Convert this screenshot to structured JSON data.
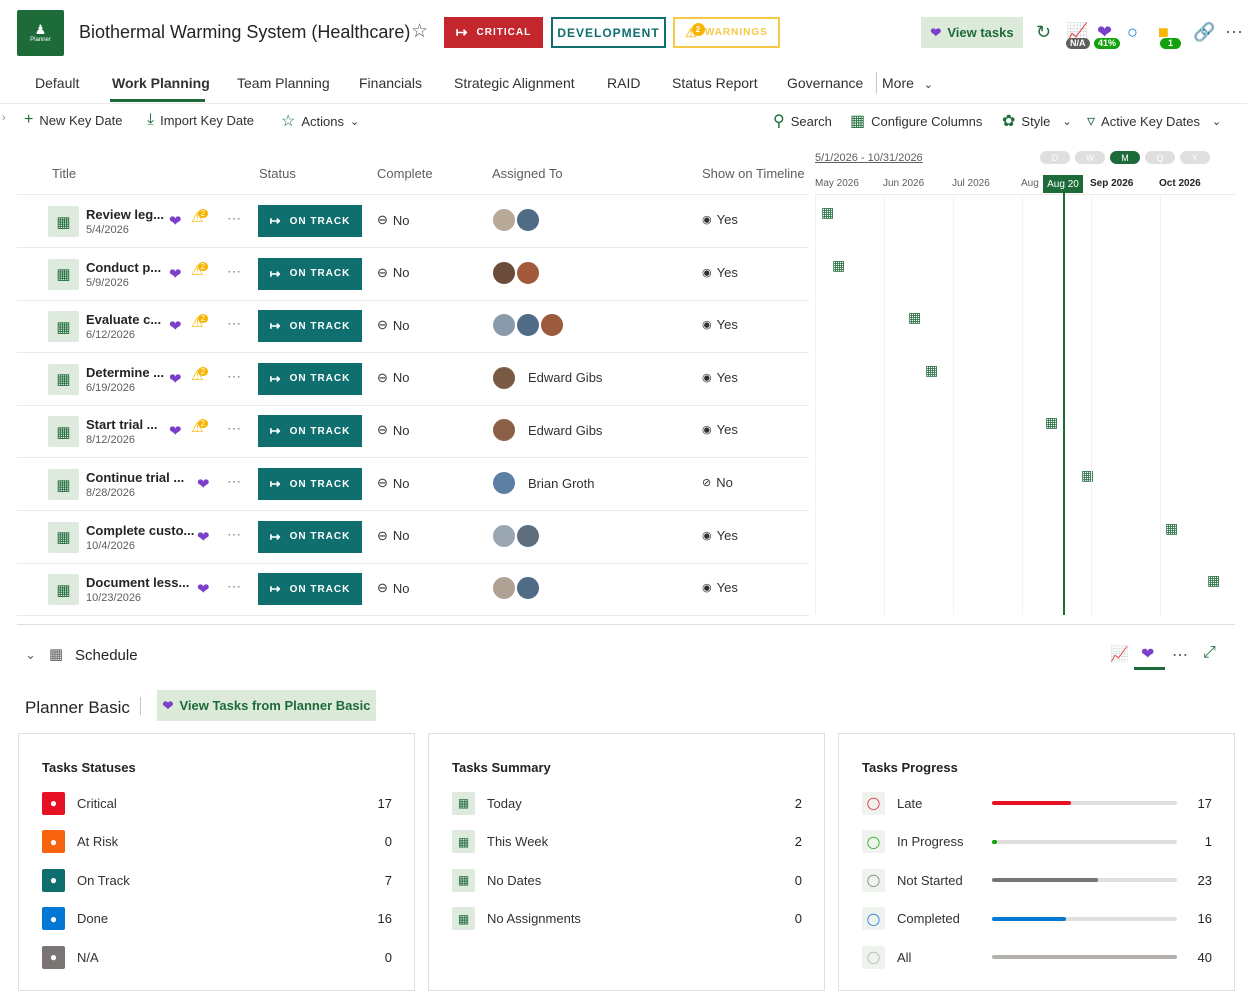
{
  "header": {
    "logo_text": "Planner",
    "title": "Biothermal Warming System (Healthcare)",
    "critical": "CRITICAL",
    "development": "DEVELOPMENT",
    "warnings": "WARNINGS",
    "warn_count": "2",
    "view_tasks": "View tasks",
    "pill_na": "N/A",
    "pill_pct": "41%",
    "pill_one": "1"
  },
  "tabs": [
    "Default",
    "Work Planning",
    "Team Planning",
    "Financials",
    "Strategic Alignment",
    "RAID",
    "Status Report",
    "Governance",
    "More"
  ],
  "toolbar": {
    "new": "New Key Date",
    "import": "Import Key Date",
    "actions": "Actions",
    "search": "Search",
    "configure": "Configure Columns",
    "style": "Style",
    "active": "Active Key Dates"
  },
  "columns": {
    "title": "Title",
    "status": "Status",
    "complete": "Complete",
    "assigned": "Assigned To",
    "show": "Show on Timeline"
  },
  "rows": [
    {
      "title": "Review leg...",
      "date": "5/4/2026",
      "status": "ON TRACK",
      "complete": "No",
      "assigned": "",
      "show": "Yes",
      "warn": "2"
    },
    {
      "title": "Conduct p...",
      "date": "5/9/2026",
      "status": "ON TRACK",
      "complete": "No",
      "assigned": "",
      "show": "Yes",
      "warn": "2"
    },
    {
      "title": "Evaluate c...",
      "date": "6/12/2026",
      "status": "ON TRACK",
      "complete": "No",
      "assigned": "",
      "show": "Yes",
      "warn": "2"
    },
    {
      "title": "Determine ...",
      "date": "6/19/2026",
      "status": "ON TRACK",
      "complete": "No",
      "assigned": "Edward Gibs",
      "show": "Yes",
      "warn": "2"
    },
    {
      "title": "Start trial ...",
      "date": "8/12/2026",
      "status": "ON TRACK",
      "complete": "No",
      "assigned": "Edward Gibs",
      "show": "Yes",
      "warn": "2"
    },
    {
      "title": "Continue trial ...",
      "date": "8/28/2026",
      "status": "ON TRACK",
      "complete": "No",
      "assigned": "Brian Groth",
      "show": "No",
      "warn": ""
    },
    {
      "title": "Complete custo...",
      "date": "10/4/2026",
      "status": "ON TRACK",
      "complete": "No",
      "assigned": "",
      "show": "Yes",
      "warn": ""
    },
    {
      "title": "Document less...",
      "date": "10/23/2026",
      "status": "ON TRACK",
      "complete": "No",
      "assigned": "",
      "show": "Yes",
      "warn": ""
    }
  ],
  "timeline": {
    "start": "5/1/2026",
    "sep": "-",
    "end": "10/31/2026",
    "scales": [
      "D",
      "W",
      "M",
      "Q",
      "Y"
    ],
    "months": [
      "May 2026",
      "Jun 2026",
      "Jul 2026",
      "Aug",
      "Sep 2026",
      "Oct 2026"
    ],
    "today": "Aug 20"
  },
  "schedule": {
    "label": "Schedule",
    "planner": "Planner Basic",
    "view_btn": "View Tasks from Planner Basic"
  },
  "statuses": {
    "title": "Tasks Statuses",
    "items": [
      {
        "label": "Critical",
        "value": "17",
        "color": "#e81123"
      },
      {
        "label": "At Risk",
        "value": "0",
        "color": "#f7630c"
      },
      {
        "label": "On Track",
        "value": "7",
        "color": "#0f6e6e"
      },
      {
        "label": "Done",
        "value": "16",
        "color": "#0078d4"
      },
      {
        "label": "N/A",
        "value": "0",
        "color": "#7a7574"
      }
    ]
  },
  "summary": {
    "title": "Tasks Summary",
    "items": [
      {
        "label": "Today",
        "value": "2"
      },
      {
        "label": "This Week",
        "value": "2"
      },
      {
        "label": "No Dates",
        "value": "0"
      },
      {
        "label": "No Assignments",
        "value": "0"
      }
    ]
  },
  "progress": {
    "title": "Tasks Progress",
    "items": [
      {
        "label": "Late",
        "value": "17",
        "fraction": 0.425,
        "color": "#e81123"
      },
      {
        "label": "In Progress",
        "value": "1",
        "fraction": 0.025,
        "color": "#13a10e"
      },
      {
        "label": "Not Started",
        "value": "23",
        "fraction": 0.575,
        "color": "#7a7574"
      },
      {
        "label": "Completed",
        "value": "16",
        "fraction": 0.4,
        "color": "#0078d4"
      },
      {
        "label": "All",
        "value": "40",
        "fraction": 1.0,
        "color": "#b3b0ad"
      }
    ]
  }
}
